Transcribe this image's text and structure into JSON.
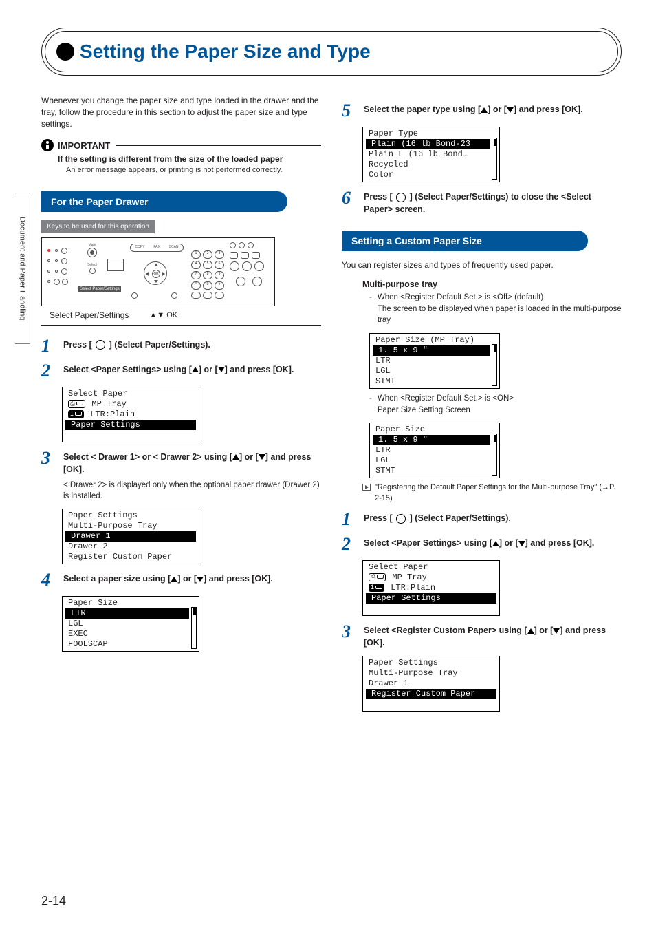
{
  "sidetab": "Document and Paper Handling",
  "title": "Setting the Paper Size and Type",
  "intro": "Whenever you change the paper size and type loaded in the drawer and the tray, follow the procedure in this section to adjust the paper size and type settings.",
  "important": {
    "label": "IMPORTANT",
    "subtitle": "If the setting is different from the size of the loaded paper",
    "body": "An error message appears, or printing is not performed correctly."
  },
  "section_drawer": "For the Paper Drawer",
  "keys_label": "Keys to be used for this operation",
  "panel_highlight": "Select Paper/Settings",
  "panel_caption_left": "Select Paper/Settings",
  "panel_caption_right": "▲▼ OK",
  "steps_left": {
    "s1": "Press [   ] (Select Paper/Settings).",
    "s2": "Select <Paper Settings> using [▲] or [▼] and press [OK].",
    "s3": "Select < Drawer 1> or < Drawer 2> using [▲] or [▼] and press [OK].",
    "s3_note": "< Drawer 2> is displayed only when the optional paper drawer (Drawer 2) is installed.",
    "s4": "Select a paper size using [▲] or [▼] and press [OK]."
  },
  "lcd_select_paper": {
    "title": "Select Paper",
    "items": [
      " MP Tray",
      " LTR:Plain",
      "Paper Settings"
    ]
  },
  "lcd_paper_settings": {
    "title": "Paper Settings",
    "items": [
      "Multi-Purpose Tray",
      "Drawer 1",
      "Drawer 2",
      "Register Custom Paper"
    ]
  },
  "lcd_paper_size": {
    "title": "Paper Size",
    "items": [
      "LTR",
      "LGL",
      "EXEC",
      "FOOLSCAP"
    ]
  },
  "steps_right": {
    "s5": "Select the paper type using [▲] or [▼] and press [OK].",
    "s6": "Press [   ]  (Select Paper/Settings) to close the <Select Paper> screen."
  },
  "lcd_paper_type": {
    "title": "Paper Type",
    "items": [
      "Plain (16 lb Bond-23",
      "Plain L (16 lb Bond…",
      "Recycled",
      "Color"
    ]
  },
  "section_custom": "Setting a Custom Paper Size",
  "custom_intro": "You can register sizes and types of frequently used paper.",
  "multi_tray_head": "Multi-purpose tray",
  "dash1a": "When <Register Default Set.> is <Off> (default)",
  "dash1b": "The screen to be displayed when paper is loaded in the multi-purpose tray",
  "lcd_mp_tray": {
    "title": "Paper Size (MP Tray)",
    "items": [
      "1. 5 x 9 \"",
      "LTR",
      "LGL",
      "STMT"
    ]
  },
  "dash2a": "When <Register Default Set.> is <ON>",
  "dash2b": "Paper Size Setting Screen",
  "lcd_paper_size2": {
    "title": "Paper Size",
    "items": [
      "1. 5 x 9 \"",
      "LTR",
      "LGL",
      "STMT"
    ]
  },
  "ref_text": "\"Registering the Default Paper Settings for the Multi-purpose Tray\" (→P. 2-15)",
  "steps_right2": {
    "s1": "Press [   ] (Select Paper/Settings).",
    "s2": "Select <Paper Settings> using [▲] or [▼] and press [OK].",
    "s3": "Select <Register Custom Paper> using [▲] or [▼] and press [OK]."
  },
  "lcd_select_paper2": {
    "title": "Select Paper",
    "items": [
      " MP Tray",
      " LTR:Plain",
      "Paper Settings"
    ]
  },
  "lcd_paper_settings2": {
    "title": "Paper Settings",
    "items": [
      "Multi-Purpose Tray",
      "Drawer 1",
      "Register Custom Paper"
    ]
  },
  "page_number": "2-14"
}
